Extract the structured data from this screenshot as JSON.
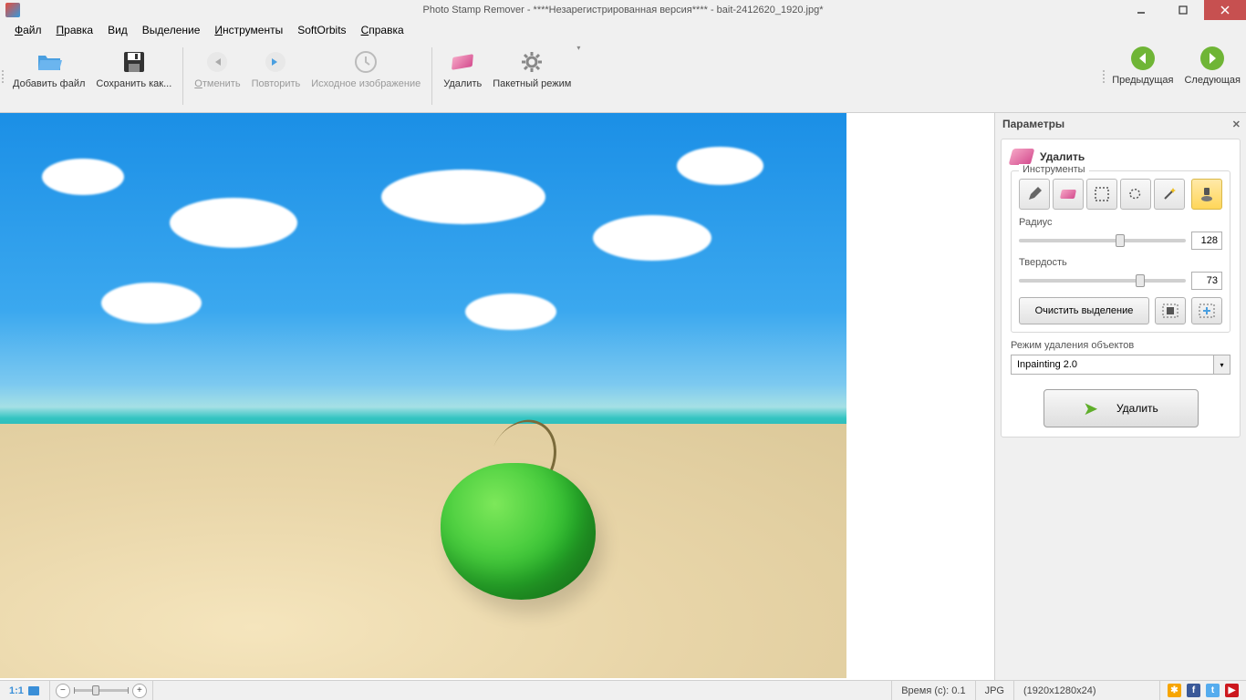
{
  "title": "Photo Stamp Remover - ****Незарегистрированная версия**** - bait-2412620_1920.jpg*",
  "menubar": {
    "file": "Файл",
    "edit": "Правка",
    "view": "Вид",
    "selection": "Выделение",
    "tools": "Инструменты",
    "softorbits": "SoftOrbits",
    "help": "Справка"
  },
  "toolbar": {
    "add_file": "Добавить файл",
    "save_as": "Сохранить как...",
    "undo": "Отменить",
    "redo": "Повторить",
    "original": "Исходное изображение",
    "delete": "Удалить",
    "batch": "Пакетный режим",
    "prev": "Предыдущая",
    "next": "Следующая"
  },
  "panel": {
    "title": "Параметры",
    "section_delete": "Удалить",
    "tools_label": "Инструменты",
    "radius_label": "Радиус",
    "radius_value": "128",
    "hardness_label": "Твердость",
    "hardness_value": "73",
    "clear_selection": "Очистить выделение",
    "mode_label": "Режим удаления объектов",
    "mode_value": "Inpainting 2.0",
    "remove_btn": "Удалить"
  },
  "status": {
    "zoom_label": "1:1",
    "time": "Время (c): 0.1",
    "format": "JPG",
    "dimensions": "(1920x1280x24)"
  }
}
